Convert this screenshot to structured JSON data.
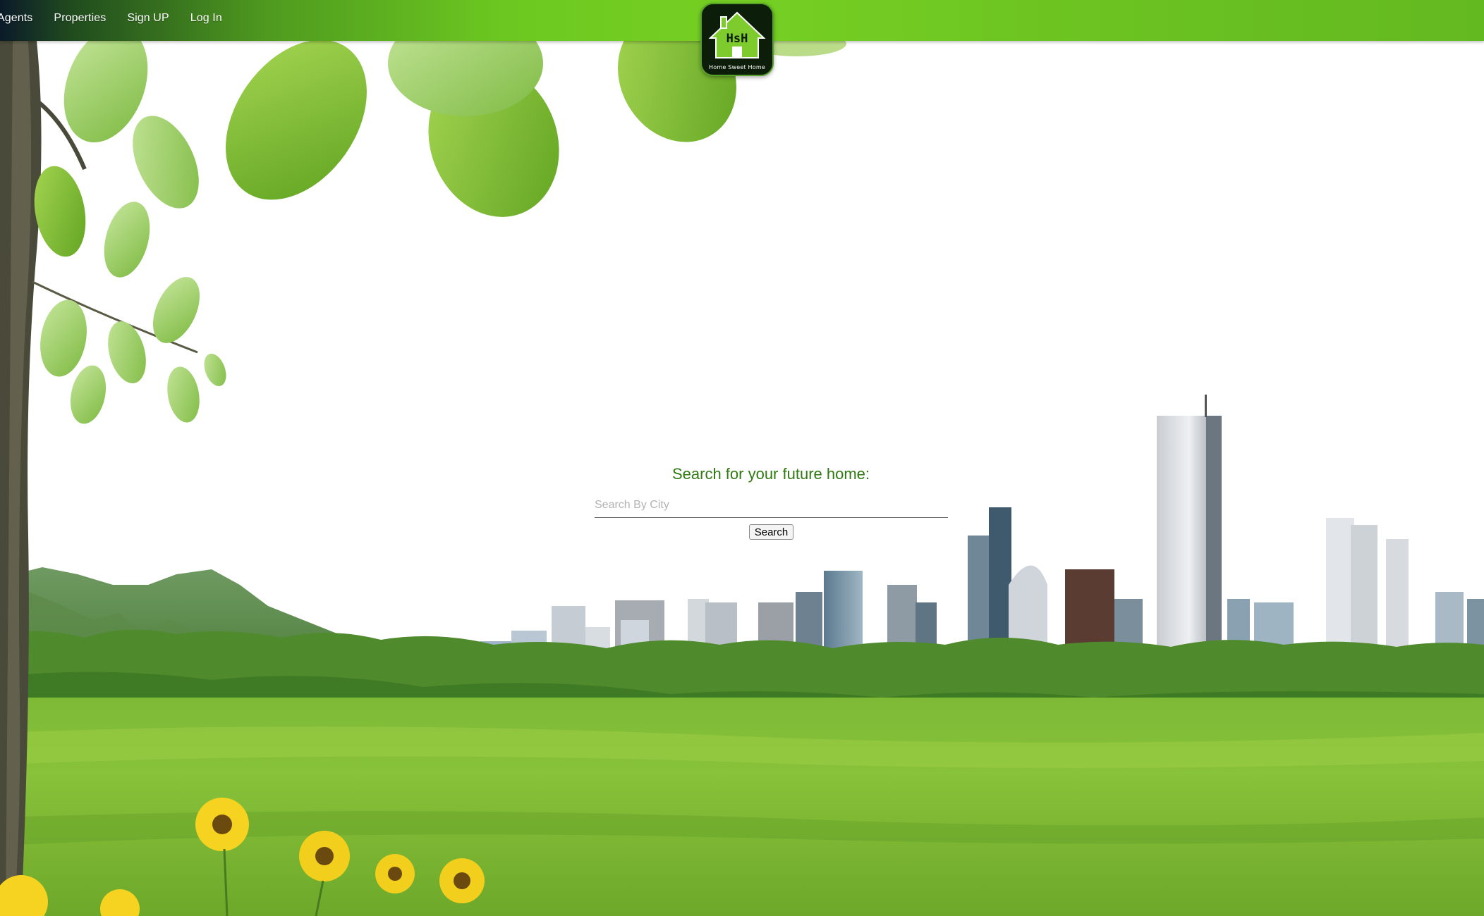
{
  "nav": {
    "items": [
      {
        "label": "Agents"
      },
      {
        "label": "Properties"
      },
      {
        "label": "Sign UP"
      },
      {
        "label": "Log In"
      }
    ]
  },
  "logo": {
    "text": "HsH",
    "subtitle": "Home Sweet Home"
  },
  "search": {
    "title": "Search for your future home:",
    "placeholder": "Search By City",
    "value": "",
    "button_label": "Search"
  },
  "colors": {
    "navbar": "#6cc820",
    "title": "#2f7a12",
    "grass": "#7fc12c",
    "leaves": "#8cc63f"
  }
}
